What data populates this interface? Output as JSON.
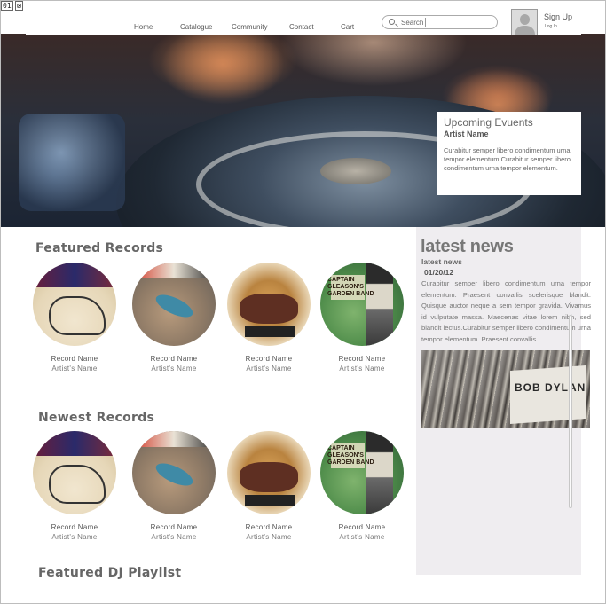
{
  "toolbar_tags": [
    "01",
    "⊠"
  ],
  "nav": {
    "items": [
      "Home",
      "Catalogue",
      "Community",
      "Contact",
      "Cart"
    ],
    "search_label": "Search",
    "search_value": "",
    "signup": "Sign Up",
    "login": "Log In"
  },
  "events": {
    "title": "Upcoming Evuents",
    "artist": "Artist Name",
    "description": "Curabitur semper libero condimentum urna tempor elementum.Curabitur semper libero condimentum urna tempor elementum."
  },
  "featured": {
    "title": "Featured Records",
    "records": [
      {
        "name": "Record Name",
        "artist": "Artist's Name"
      },
      {
        "name": "Record Name",
        "artist": "Artist's Name"
      },
      {
        "name": "Record Name",
        "artist": "Artist's Name"
      },
      {
        "name": "Record Name",
        "artist": "Artist's Name"
      }
    ]
  },
  "newest": {
    "title": "Newest Records",
    "records": [
      {
        "name": "Record Name",
        "artist": "Artist's Name"
      },
      {
        "name": "Record Name",
        "artist": "Artist's Name"
      },
      {
        "name": "Record Name",
        "artist": "Artist's Name"
      },
      {
        "name": "Record Name",
        "artist": "Artist's Name"
      }
    ]
  },
  "playlist": {
    "title": "Featured DJ Playlist"
  },
  "news": {
    "title": "latest news",
    "subtitle": "latest news",
    "date": "01/20/12",
    "body": "Curabitur semper libero condimentum urna tempor elementum. Praesent convallis scelerisque blandit. Quisque auctor neque a sem tempor gravida. Vivamus id vulputate massa. Maecenas vitae lorem nibh, sed blandit lectus.Curabitur semper libero condimentum urna tempor elementum. Praesent convallis",
    "photo_text": "BOB DYLAN"
  },
  "cover_text": {
    "cover4": "CAPTAIN\nGLEASON'S\nGARDEN BAND"
  },
  "colors": {
    "panel": "#efedf0",
    "heading": "#666666",
    "text": "#777777"
  }
}
